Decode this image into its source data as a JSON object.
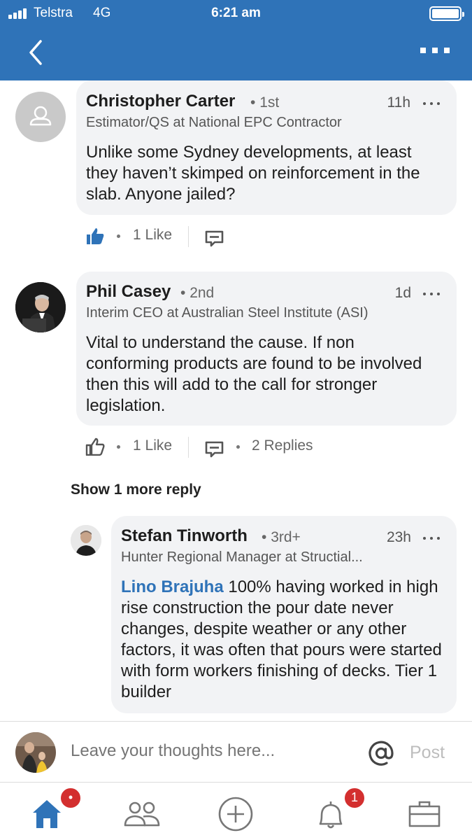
{
  "status_bar": {
    "carrier": "Telstra",
    "network": "4G",
    "time": "6:21 am"
  },
  "header": {
    "back_icon": "chevron-left-icon",
    "menu_icon": "more-horizontal-icon",
    "color": "#2f73b8"
  },
  "comments": [
    {
      "author": "Christopher Carter",
      "degree": "1st",
      "time": "11h",
      "headline": "Estimator/QS at National EPC Contractor",
      "text": "Unlike some Sydney developments, at least they haven’t skimped on reinforcement in the slab. Anyone jailed?",
      "likes": "1 Like",
      "liked": true
    },
    {
      "author": "Phil Casey",
      "degree": "2nd",
      "time": "1d",
      "headline": "Interim CEO at Australian Steel Institute (ASI)",
      "text": "Vital to understand the cause. If non conforming products are found to be involved then this will add to the call for stronger legislation.",
      "likes": "1 Like",
      "replies": "2 Replies",
      "liked": false
    }
  ],
  "show_more": "Show 1 more reply",
  "reply": {
    "author": "Stefan Tinworth",
    "degree": "3rd+",
    "time": "23h",
    "headline": "Hunter Regional Manager at Structial...",
    "mention": "Lino Brajuha",
    "text": " 100% having worked in high rise construction the pour date never changes, despite weather or any other factors, it was often that pours were started with form workers finishing of decks. Tier 1 builder"
  },
  "composer": {
    "placeholder": "Leave your thoughts here...",
    "at_icon": "at-sign-icon",
    "post_label": "Post"
  },
  "tabs": [
    {
      "icon": "home-icon",
      "badge": "•",
      "active": true
    },
    {
      "icon": "my-network-icon"
    },
    {
      "icon": "post-plus-icon"
    },
    {
      "icon": "notifications-bell-icon",
      "badge": "1"
    },
    {
      "icon": "jobs-briefcase-icon"
    }
  ],
  "colors": {
    "accent": "#2f73b8",
    "badge": "#d32f2f",
    "bubble": "#f2f3f5"
  }
}
